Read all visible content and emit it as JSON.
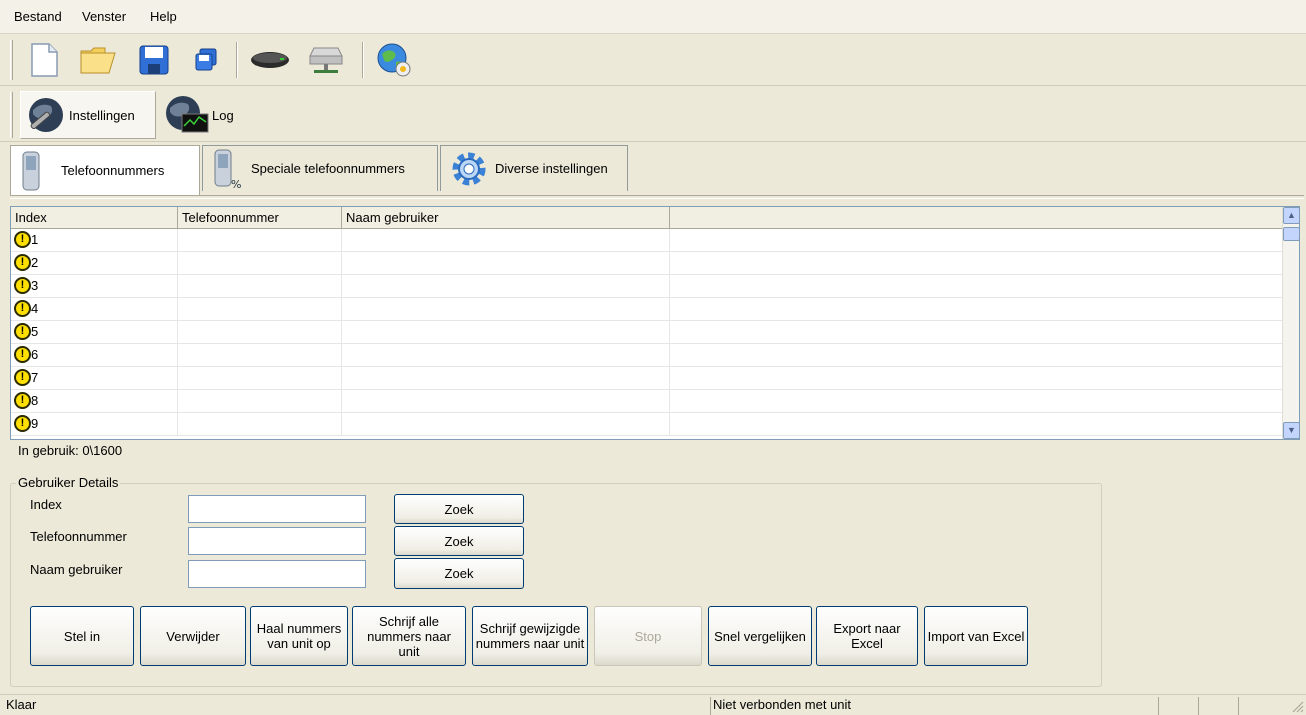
{
  "menu": [
    "Bestand",
    "Venster",
    "Help"
  ],
  "toolbar": {
    "icons": [
      "new-file-icon",
      "open-folder-icon",
      "save-icon",
      "save-all-icon",
      "device-icon",
      "network-drive-icon",
      "globe-help-icon"
    ]
  },
  "views": [
    {
      "label": "Instellingen",
      "icon": "settings-globe-icon",
      "active": true
    },
    {
      "label": "Log",
      "icon": "log-globe-icon",
      "active": false
    }
  ],
  "tabs": [
    {
      "label": "Telefoonnummers",
      "icon": "phone-icon",
      "active": true
    },
    {
      "label": "Speciale telefoonnummers",
      "icon": "special-phone-icon",
      "active": false
    },
    {
      "label": "Diverse instellingen",
      "icon": "gear-icon",
      "active": false
    }
  ],
  "table": {
    "columns": [
      "Index",
      "Telefoonnummer",
      "Naam gebruiker",
      ""
    ],
    "rows": [
      {
        "index": "1",
        "phone": "",
        "name": ""
      },
      {
        "index": "2",
        "phone": "",
        "name": ""
      },
      {
        "index": "3",
        "phone": "",
        "name": ""
      },
      {
        "index": "4",
        "phone": "",
        "name": ""
      },
      {
        "index": "5",
        "phone": "",
        "name": ""
      },
      {
        "index": "6",
        "phone": "",
        "name": ""
      },
      {
        "index": "7",
        "phone": "",
        "name": ""
      },
      {
        "index": "8",
        "phone": "",
        "name": ""
      },
      {
        "index": "9",
        "phone": "",
        "name": ""
      }
    ]
  },
  "usage_text": "In gebruik: 0\\1600",
  "details": {
    "title": "Gebruiker Details",
    "fields": [
      {
        "label": "Index",
        "value": "",
        "button": "Zoek"
      },
      {
        "label": "Telefoonnummer",
        "value": "",
        "button": "Zoek"
      },
      {
        "label": "Naam gebruiker",
        "value": "",
        "button": "Zoek"
      }
    ]
  },
  "actions": [
    {
      "label": "Stel in",
      "enabled": true
    },
    {
      "label": "Verwijder",
      "enabled": true
    },
    {
      "label": "Haal nummers van unit op",
      "enabled": true
    },
    {
      "label": "Schrijf alle nummers naar unit",
      "enabled": true
    },
    {
      "label": "Schrijf gewijzigde nummers naar unit",
      "enabled": true
    },
    {
      "label": "Stop",
      "enabled": false
    },
    {
      "label": "Snel vergelijken",
      "enabled": true
    },
    {
      "label": "Export naar Excel",
      "enabled": true
    },
    {
      "label": "Import van Excel",
      "enabled": true
    }
  ],
  "status": {
    "left": "Klaar",
    "connection": "Niet verbonden met unit"
  },
  "colors": {
    "window_bg": "#ece9d8",
    "warning_yellow": "#ffe000",
    "list_border": "#7f9db9"
  }
}
